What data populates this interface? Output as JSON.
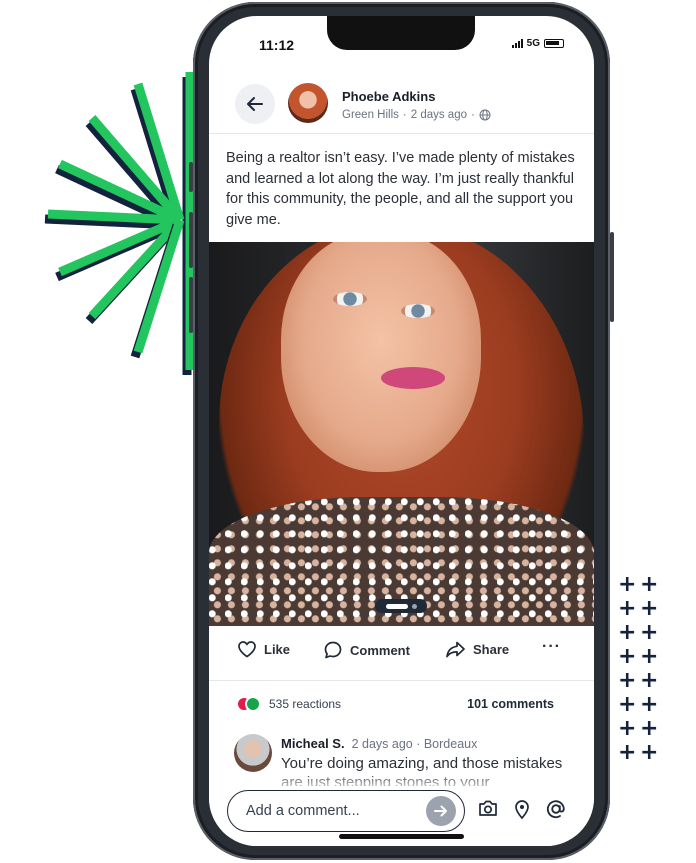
{
  "status_bar": {
    "time": "11:12",
    "network": "5G"
  },
  "post": {
    "author": "Phoebe Adkins",
    "location": "Green Hills",
    "time_ago": "2 days ago",
    "separator": "·",
    "text": "Being a realtor isn’t easy. I’ve made plenty of mistakes and learned a lot along the way. I’m just really thankful for this community, the people, and all the support you give me.",
    "photo_pages": 2,
    "photo_current_page": 1
  },
  "actions": {
    "like": "Like",
    "comment": "Comment",
    "share": "Share",
    "more": "···"
  },
  "stats": {
    "reactions": "535 reactions",
    "comments": "101 comments"
  },
  "comment": {
    "name": "Micheal S.",
    "meta": "2 days ago · Bordeaux",
    "text": "You’re doing amazing, and those mistakes are just stepping stones to your"
  },
  "composer": {
    "placeholder": "Add a comment..."
  },
  "icons": [
    "back-arrow-icon",
    "globe-icon",
    "heart-icon",
    "speech-bubble-icon",
    "share-arrow-icon",
    "more-icon",
    "arrow-right-icon",
    "camera-icon",
    "location-pin-icon",
    "at-sign-icon"
  ],
  "colors": {
    "accent_green": "#22c55e",
    "navy": "#14233d",
    "reaction_red": "#e11d48",
    "reaction_green": "#16a34a"
  }
}
